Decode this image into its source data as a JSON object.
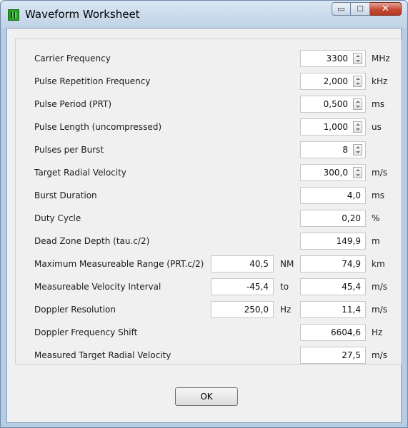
{
  "window": {
    "title": "Waveform Worksheet",
    "minimize_glyph": "▭",
    "maximize_glyph": "☐",
    "close_glyph": "✕"
  },
  "rows": [
    {
      "label": "Carrier Frequency",
      "value": "3300",
      "unit": "MHz",
      "spinner": true
    },
    {
      "label": "Pulse Repetition Frequency",
      "value": "2,000",
      "unit": "kHz",
      "spinner": true
    },
    {
      "label": "Pulse Period (PRT)",
      "value": "0,500",
      "unit": "ms",
      "spinner": true
    },
    {
      "label": "Pulse Length (uncompressed)",
      "value": "1,000",
      "unit": "us",
      "spinner": true
    },
    {
      "label": "Pulses per Burst",
      "value": "8",
      "unit": "",
      "spinner": true
    },
    {
      "label": "Target Radial Velocity",
      "value": "300,0",
      "unit": "m/s",
      "spinner": true
    },
    {
      "label": "Burst Duration",
      "value": "4,0",
      "unit": "ms"
    },
    {
      "label": "Duty Cycle",
      "value": "0,20",
      "unit": "%"
    },
    {
      "label": "Dead Zone Depth (tau.c/2)",
      "value": "149,9",
      "unit": "m"
    },
    {
      "label": "Maximum Measureable Range (PRT.c/2)",
      "mid_value": "40,5",
      "mid_unit": "NM",
      "value": "74,9",
      "unit": "km"
    },
    {
      "label": "Measureable Velocity Interval",
      "mid_value": "-45,4",
      "mid_unit": "to",
      "value": "45,4",
      "unit": "m/s"
    },
    {
      "label": "Doppler Resolution",
      "mid_value": "250,0",
      "mid_unit": "Hz",
      "value": "11,4",
      "unit": "m/s"
    },
    {
      "label": "Doppler Frequency Shift",
      "value": "6604,6",
      "unit": "Hz"
    },
    {
      "label": "Measured Target Radial Velocity",
      "value": "27,5",
      "unit": "m/s"
    }
  ],
  "ok_label": "OK"
}
